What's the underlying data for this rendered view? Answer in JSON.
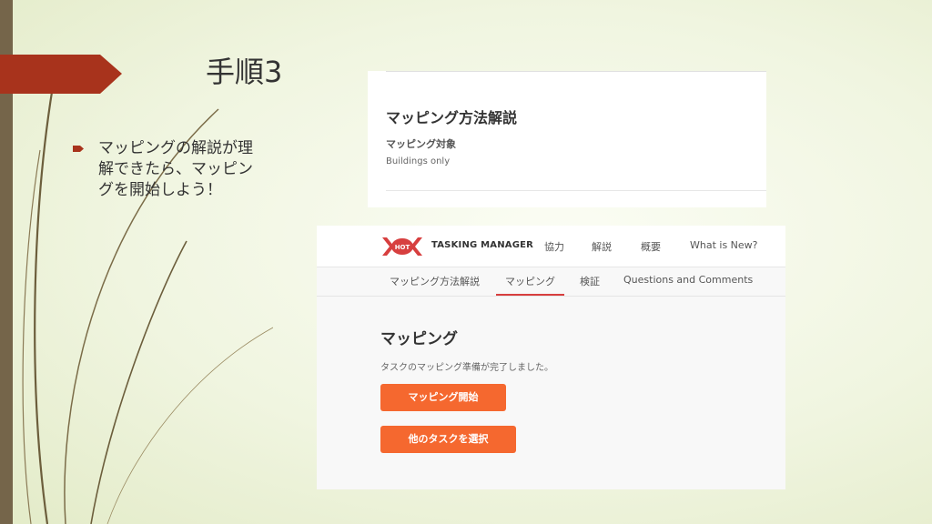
{
  "slide": {
    "title": "手順3",
    "bullet": "マッピングの解説が理解できたら、マッピングを開始しよう！"
  },
  "top_panel": {
    "heading": "マッピング方法解説",
    "subheading": "マッピング対象",
    "value": "Buildings only"
  },
  "tasking_manager": {
    "logo_text": "HOT",
    "brand": "TASKING MANAGER",
    "nav": [
      "協力",
      "解説",
      "概要",
      "What is New?"
    ],
    "tabs": [
      "マッピング方法解説",
      "マッピング",
      "検証",
      "Questions and Comments"
    ],
    "active_tab": "マッピング",
    "heading": "マッピング",
    "status": "タスクのマッピング準備が完了しました。",
    "start_button": "マッピング開始",
    "select_button": "他のタスクを選択"
  },
  "colors": {
    "accent": "#f5682f",
    "banner": "#a8331c",
    "tab_active": "#d73f3f"
  }
}
